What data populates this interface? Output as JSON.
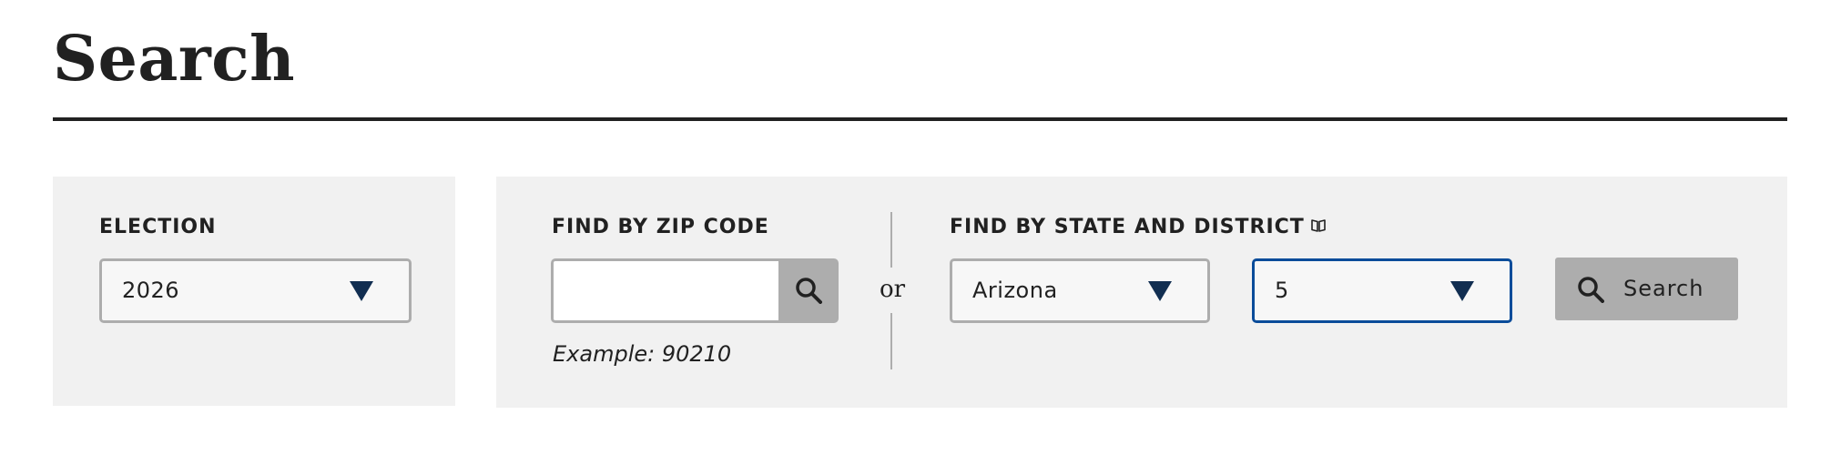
{
  "page": {
    "title": "Search"
  },
  "election": {
    "label": "ELECTION",
    "selected": "2026"
  },
  "zip": {
    "label": "FIND BY ZIP CODE",
    "value": "",
    "placeholder": "",
    "example": "Example: 90210"
  },
  "divider": {
    "or_label": "or"
  },
  "state_district": {
    "label": "FIND BY STATE AND DISTRICT",
    "state_selected": "Arizona",
    "district_selected": "5"
  },
  "search_button": {
    "label": "Search"
  },
  "icons": {
    "caret": "chevron-down-icon",
    "zip_search": "search-icon",
    "glossary": "book-icon",
    "search_button": "search-icon"
  },
  "colors": {
    "caret": "#112e51",
    "focus_border": "#0a4c9a",
    "panel_background": "#f1f1f1",
    "button_background": "#adadad",
    "title_rule": "#212121"
  }
}
